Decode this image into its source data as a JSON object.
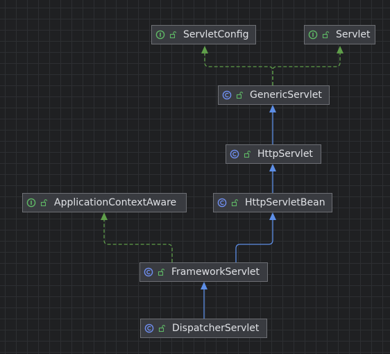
{
  "diagram": {
    "nodes": [
      {
        "id": "servletconfig",
        "label": "ServletConfig",
        "kind": "interface",
        "icon": "interface-icon"
      },
      {
        "id": "servlet",
        "label": "Servlet",
        "kind": "interface",
        "icon": "interface-icon"
      },
      {
        "id": "genericservlet",
        "label": "GenericServlet",
        "kind": "class",
        "icon": "class-icon"
      },
      {
        "id": "httpservlet",
        "label": "HttpServlet",
        "kind": "class",
        "icon": "class-icon"
      },
      {
        "id": "applicationcontextaware",
        "label": "ApplicationContextAware",
        "kind": "interface",
        "icon": "interface-icon"
      },
      {
        "id": "httpservletbean",
        "label": "HttpServletBean",
        "kind": "class",
        "icon": "class-icon"
      },
      {
        "id": "frameworkservlet",
        "label": "FrameworkServlet",
        "kind": "class",
        "icon": "class-icon"
      },
      {
        "id": "dispatcherservlet",
        "label": "DispatcherServlet",
        "kind": "class",
        "icon": "class-icon"
      }
    ],
    "edges": [
      {
        "from": "genericservlet",
        "to": "servletconfig",
        "type": "implements"
      },
      {
        "from": "genericservlet",
        "to": "servlet",
        "type": "implements"
      },
      {
        "from": "httpservlet",
        "to": "genericservlet",
        "type": "extends"
      },
      {
        "from": "httpservletbean",
        "to": "httpservlet",
        "type": "extends"
      },
      {
        "from": "frameworkservlet",
        "to": "httpservletbean",
        "type": "extends"
      },
      {
        "from": "frameworkservlet",
        "to": "applicationcontextaware",
        "type": "implements"
      },
      {
        "from": "dispatcherservlet",
        "to": "frameworkservlet",
        "type": "extends"
      }
    ]
  },
  "colors": {
    "background": "#1f2022",
    "grid": "#2d2f32",
    "node_fill": "#393b40",
    "node_border": "#6e7075",
    "text": "#dfe1e5",
    "extends_edge": "#5d8ee6",
    "implements_edge": "#5f9e4a",
    "interface_icon": "#5fb865",
    "class_icon": "#6f8ef0"
  }
}
